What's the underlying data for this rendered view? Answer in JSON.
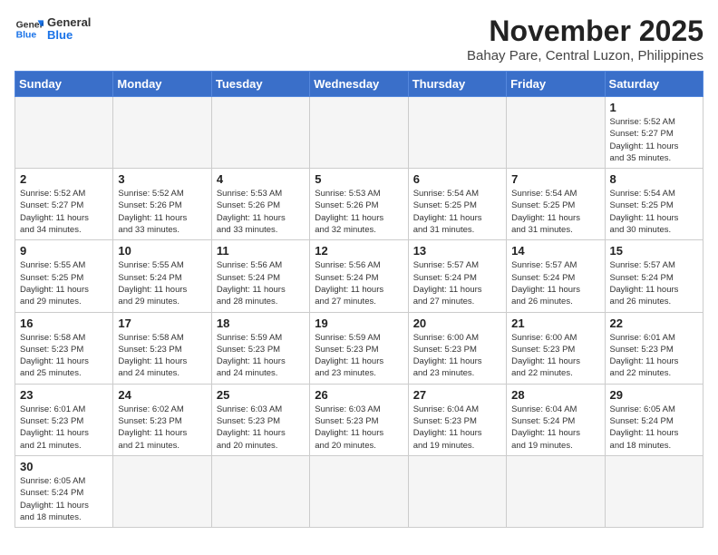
{
  "logo": {
    "line1": "General",
    "line2": "Blue"
  },
  "header": {
    "month": "November 2025",
    "location": "Bahay Pare, Central Luzon, Philippines"
  },
  "weekdays": [
    "Sunday",
    "Monday",
    "Tuesday",
    "Wednesday",
    "Thursday",
    "Friday",
    "Saturday"
  ],
  "weeks": [
    [
      {
        "day": "",
        "info": ""
      },
      {
        "day": "",
        "info": ""
      },
      {
        "day": "",
        "info": ""
      },
      {
        "day": "",
        "info": ""
      },
      {
        "day": "",
        "info": ""
      },
      {
        "day": "",
        "info": ""
      },
      {
        "day": "1",
        "info": "Sunrise: 5:52 AM\nSunset: 5:27 PM\nDaylight: 11 hours\nand 35 minutes."
      }
    ],
    [
      {
        "day": "2",
        "info": "Sunrise: 5:52 AM\nSunset: 5:27 PM\nDaylight: 11 hours\nand 34 minutes."
      },
      {
        "day": "3",
        "info": "Sunrise: 5:52 AM\nSunset: 5:26 PM\nDaylight: 11 hours\nand 33 minutes."
      },
      {
        "day": "4",
        "info": "Sunrise: 5:53 AM\nSunset: 5:26 PM\nDaylight: 11 hours\nand 33 minutes."
      },
      {
        "day": "5",
        "info": "Sunrise: 5:53 AM\nSunset: 5:26 PM\nDaylight: 11 hours\nand 32 minutes."
      },
      {
        "day": "6",
        "info": "Sunrise: 5:54 AM\nSunset: 5:25 PM\nDaylight: 11 hours\nand 31 minutes."
      },
      {
        "day": "7",
        "info": "Sunrise: 5:54 AM\nSunset: 5:25 PM\nDaylight: 11 hours\nand 31 minutes."
      },
      {
        "day": "8",
        "info": "Sunrise: 5:54 AM\nSunset: 5:25 PM\nDaylight: 11 hours\nand 30 minutes."
      }
    ],
    [
      {
        "day": "9",
        "info": "Sunrise: 5:55 AM\nSunset: 5:25 PM\nDaylight: 11 hours\nand 29 minutes."
      },
      {
        "day": "10",
        "info": "Sunrise: 5:55 AM\nSunset: 5:24 PM\nDaylight: 11 hours\nand 29 minutes."
      },
      {
        "day": "11",
        "info": "Sunrise: 5:56 AM\nSunset: 5:24 PM\nDaylight: 11 hours\nand 28 minutes."
      },
      {
        "day": "12",
        "info": "Sunrise: 5:56 AM\nSunset: 5:24 PM\nDaylight: 11 hours\nand 27 minutes."
      },
      {
        "day": "13",
        "info": "Sunrise: 5:57 AM\nSunset: 5:24 PM\nDaylight: 11 hours\nand 27 minutes."
      },
      {
        "day": "14",
        "info": "Sunrise: 5:57 AM\nSunset: 5:24 PM\nDaylight: 11 hours\nand 26 minutes."
      },
      {
        "day": "15",
        "info": "Sunrise: 5:57 AM\nSunset: 5:24 PM\nDaylight: 11 hours\nand 26 minutes."
      }
    ],
    [
      {
        "day": "16",
        "info": "Sunrise: 5:58 AM\nSunset: 5:23 PM\nDaylight: 11 hours\nand 25 minutes."
      },
      {
        "day": "17",
        "info": "Sunrise: 5:58 AM\nSunset: 5:23 PM\nDaylight: 11 hours\nand 24 minutes."
      },
      {
        "day": "18",
        "info": "Sunrise: 5:59 AM\nSunset: 5:23 PM\nDaylight: 11 hours\nand 24 minutes."
      },
      {
        "day": "19",
        "info": "Sunrise: 5:59 AM\nSunset: 5:23 PM\nDaylight: 11 hours\nand 23 minutes."
      },
      {
        "day": "20",
        "info": "Sunrise: 6:00 AM\nSunset: 5:23 PM\nDaylight: 11 hours\nand 23 minutes."
      },
      {
        "day": "21",
        "info": "Sunrise: 6:00 AM\nSunset: 5:23 PM\nDaylight: 11 hours\nand 22 minutes."
      },
      {
        "day": "22",
        "info": "Sunrise: 6:01 AM\nSunset: 5:23 PM\nDaylight: 11 hours\nand 22 minutes."
      }
    ],
    [
      {
        "day": "23",
        "info": "Sunrise: 6:01 AM\nSunset: 5:23 PM\nDaylight: 11 hours\nand 21 minutes."
      },
      {
        "day": "24",
        "info": "Sunrise: 6:02 AM\nSunset: 5:23 PM\nDaylight: 11 hours\nand 21 minutes."
      },
      {
        "day": "25",
        "info": "Sunrise: 6:03 AM\nSunset: 5:23 PM\nDaylight: 11 hours\nand 20 minutes."
      },
      {
        "day": "26",
        "info": "Sunrise: 6:03 AM\nSunset: 5:23 PM\nDaylight: 11 hours\nand 20 minutes."
      },
      {
        "day": "27",
        "info": "Sunrise: 6:04 AM\nSunset: 5:23 PM\nDaylight: 11 hours\nand 19 minutes."
      },
      {
        "day": "28",
        "info": "Sunrise: 6:04 AM\nSunset: 5:24 PM\nDaylight: 11 hours\nand 19 minutes."
      },
      {
        "day": "29",
        "info": "Sunrise: 6:05 AM\nSunset: 5:24 PM\nDaylight: 11 hours\nand 18 minutes."
      }
    ],
    [
      {
        "day": "30",
        "info": "Sunrise: 6:05 AM\nSunset: 5:24 PM\nDaylight: 11 hours\nand 18 minutes."
      },
      {
        "day": "",
        "info": ""
      },
      {
        "day": "",
        "info": ""
      },
      {
        "day": "",
        "info": ""
      },
      {
        "day": "",
        "info": ""
      },
      {
        "day": "",
        "info": ""
      },
      {
        "day": "",
        "info": ""
      }
    ]
  ]
}
